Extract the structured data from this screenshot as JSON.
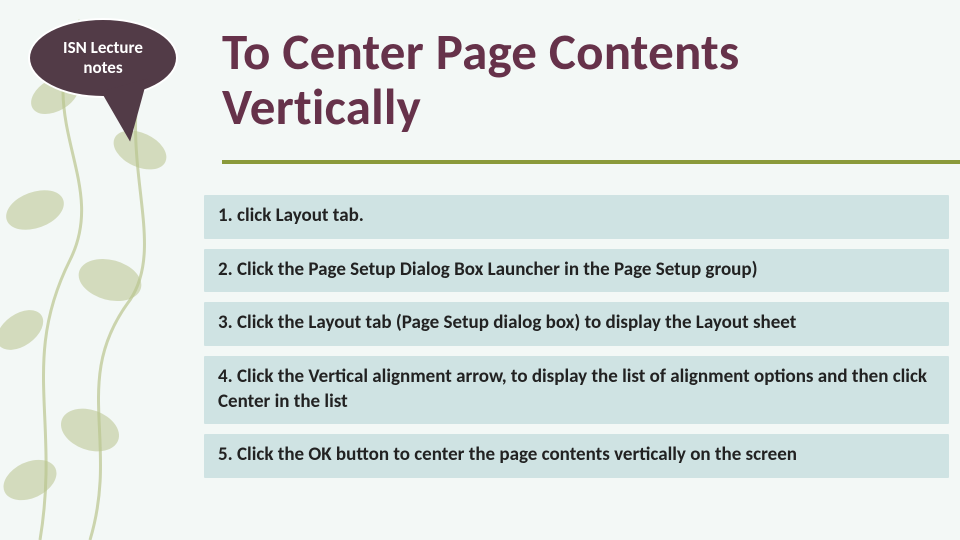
{
  "callout": {
    "text": "ISN Lecture notes"
  },
  "title": "To Center Page Contents Vertically",
  "steps": [
    "1. click Layout tab.",
    "2. Click the Page Setup Dialog Box Launcher in the Page Setup group)",
    "3. Click the Layout tab (Page Setup dialog box) to display the Layout sheet",
    "4. Click the Vertical alignment arrow, to display the list of alignment options and then click Center in the list",
    "5. Click the OK button to center the page contents vertically on the screen"
  ],
  "colors": {
    "title": "#66324A",
    "rule": "#8a9a3a",
    "stepBg": "#cfe3e3",
    "callout": "#523B47",
    "slideBg": "#f3f8f6"
  }
}
